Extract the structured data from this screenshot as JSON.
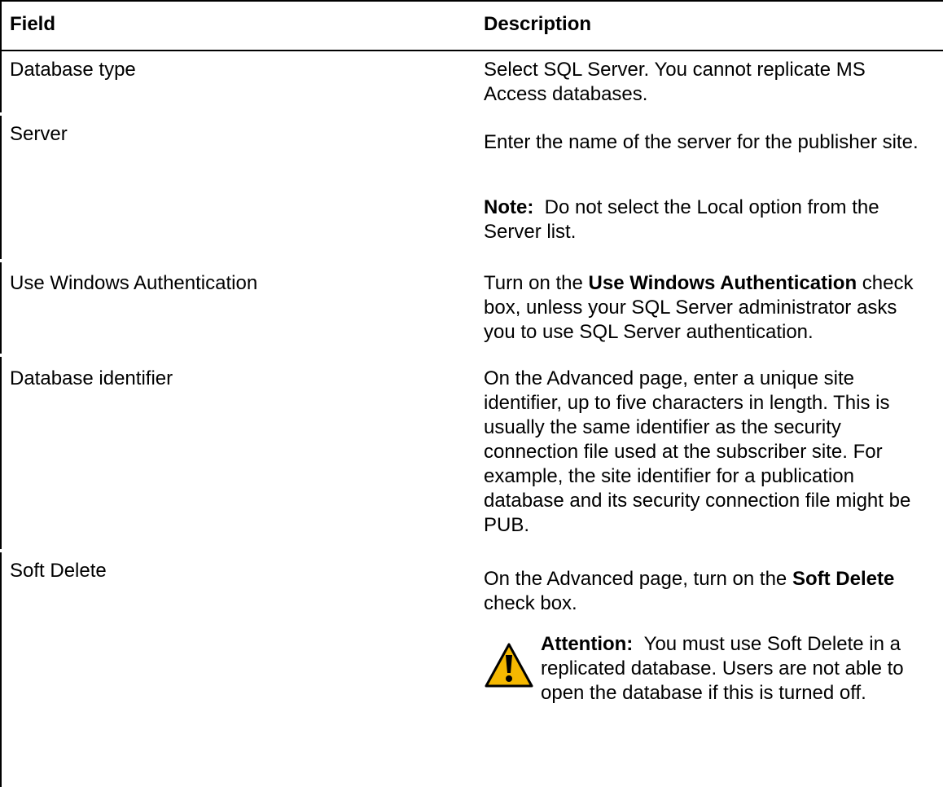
{
  "header": {
    "field_label": "Field",
    "description_label": "Description"
  },
  "rows": [
    {
      "field": "Database type",
      "description": "Select SQL Server. You cannot replicate MS Access databases."
    },
    {
      "field": "Server",
      "description": "Enter the name of the server for the publisher site.",
      "note_label": "Note:",
      "note_text": "Do not select the Local option from the Server list."
    },
    {
      "field": "Use Windows Authentication",
      "desc_prefix": "Turn on the ",
      "desc_bold": "Use Windows Authentication",
      "desc_suffix": " check box, unless your SQL Server administrator asks you to use SQL Server authentication."
    },
    {
      "field": "Database identifier",
      "description": "On the Advanced page, enter a unique site identifier, up to five characters in length. This is usually the same identifier as the security connection file used at the subscriber site. For example, the site identifier for a publication database and its security connection file might be PUB."
    },
    {
      "field": "Soft Delete",
      "desc_prefix": "On the Advanced page, turn on the ",
      "desc_bold": "Soft Delete",
      "desc_suffix": " check box.",
      "attention_label": "Attention:",
      "attention_text": "You must use Soft Delete in a replicated database. Users are not able to open the database if this is turned off.",
      "attention_icon": "warning-triangle-icon"
    }
  ],
  "colors": {
    "border": "#000000",
    "warning_fill": "#F5B800",
    "warning_stroke": "#000000"
  }
}
